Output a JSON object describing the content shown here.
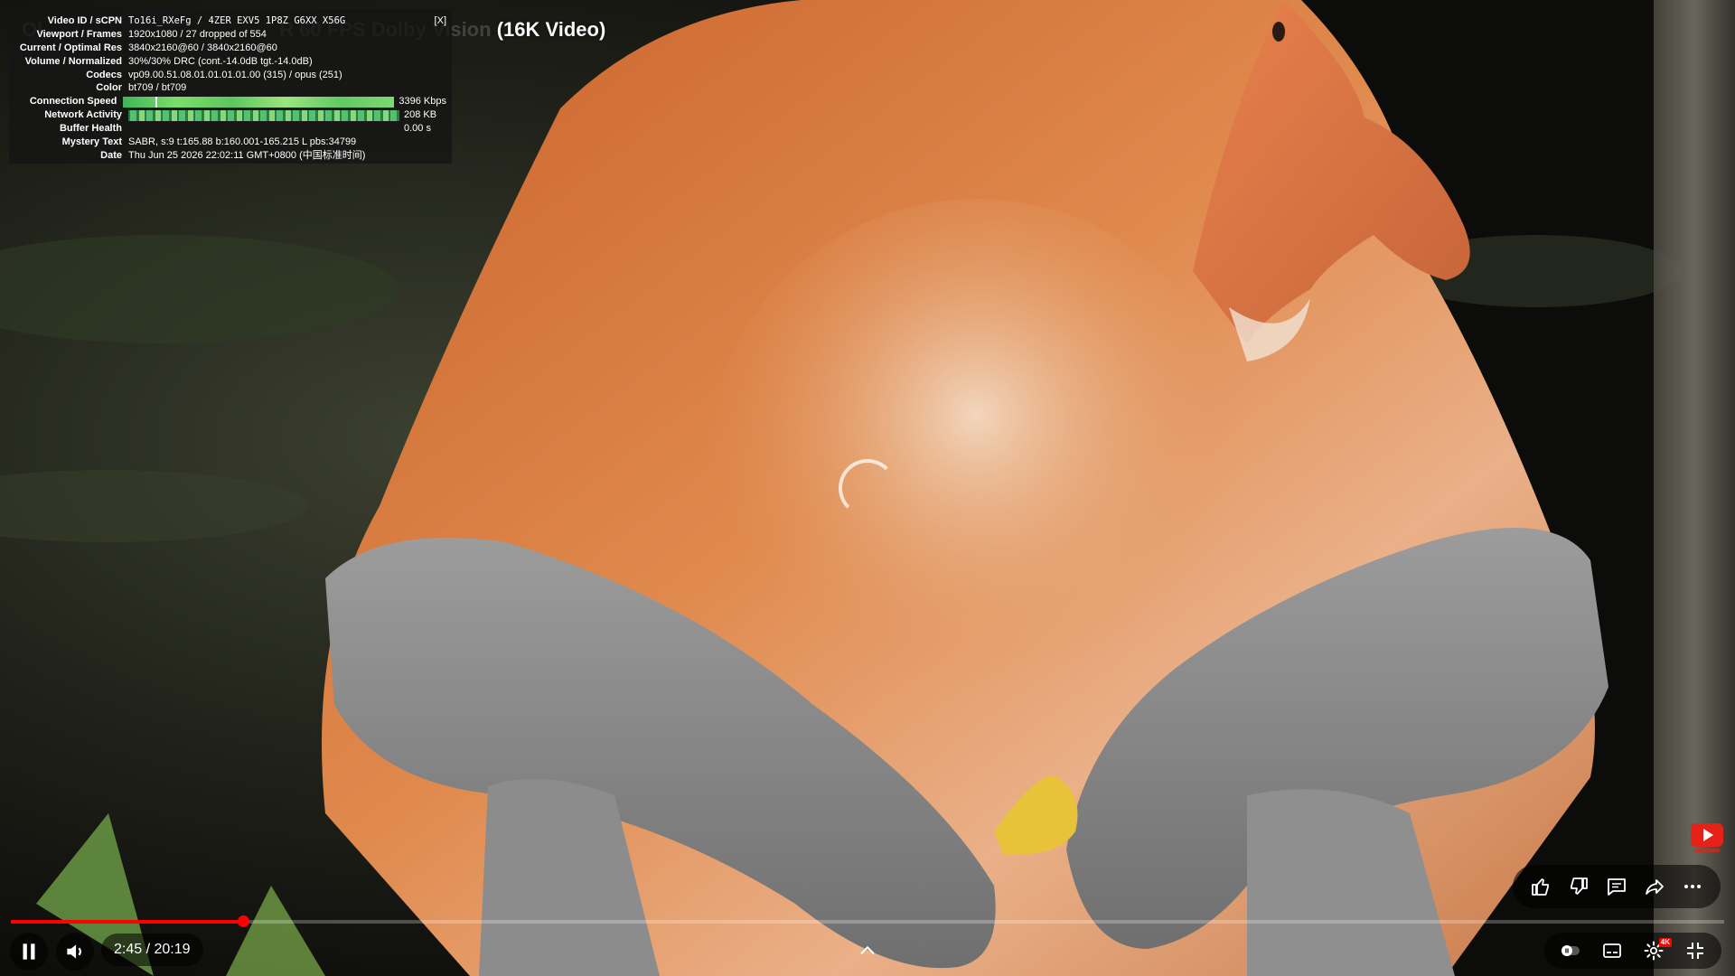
{
  "video": {
    "title_hidden": "Ol",
    "title_hidden2": "R 60 FPS Dolby Vision",
    "title_visible": "(16K Video)"
  },
  "stats": {
    "close_label": "[X]",
    "rows": [
      {
        "label": "Video ID / sCPN",
        "value": "To16i_RXeFg  /  4ZER EXV5 1P8Z G6XX X56G"
      },
      {
        "label": "Viewport / Frames",
        "value": "1920x1080 / 27 dropped of 554"
      },
      {
        "label": "Current / Optimal Res",
        "value": "3840x2160@60 / 3840x2160@60"
      },
      {
        "label": "Volume / Normalized",
        "value": "30%/30% DRC (cont.-14.0dB tgt.-14.0dB)"
      },
      {
        "label": "Codecs",
        "value": "vp09.00.51.08.01.01.01.01.00 (315) / opus (251)"
      },
      {
        "label": "Color",
        "value": "bt709 / bt709"
      },
      {
        "label": "Connection Speed",
        "value": "3396 Kbps"
      },
      {
        "label": "Network Activity",
        "value": "208 KB"
      },
      {
        "label": "Buffer Health",
        "value": "0.00 s"
      },
      {
        "label": "Mystery Text",
        "value": "SABR, s:9 t:165.88 b:160.001-165.215 L pbs:34799"
      },
      {
        "label": "Date",
        "value": "Thu Jun 25 2026 22:02:11 GMT+0800 (中国标准时间)"
      }
    ]
  },
  "player": {
    "time_display": "2:45 / 20:19",
    "progress": 0.1353,
    "accent": "#ff0000",
    "quality_badge": "4K"
  },
  "actions": {
    "like": "thumbs-up-icon",
    "dislike": "thumbs-down-icon",
    "comments": "comment-icon",
    "share": "share-icon",
    "more": "more-icon"
  }
}
